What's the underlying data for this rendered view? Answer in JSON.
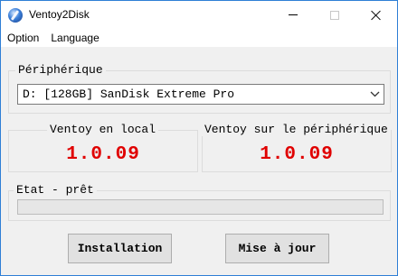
{
  "window": {
    "title": "Ventoy2Disk"
  },
  "menu": [
    "Option",
    "Language"
  ],
  "device": {
    "group_label": "Périphérique",
    "selected": "D: [128GB] SanDisk Extreme Pro"
  },
  "versions": {
    "local": {
      "label": "Ventoy en local",
      "value": "1.0.09"
    },
    "device": {
      "label": "Ventoy sur le périphérique",
      "value": "1.0.09"
    }
  },
  "status": {
    "label": "Etat - prêt",
    "progress": 0
  },
  "buttons": {
    "install": "Installation",
    "update": "Mise à jour"
  },
  "colors": {
    "version_text": "#e00000",
    "accent_border": "#2f7fd6"
  }
}
